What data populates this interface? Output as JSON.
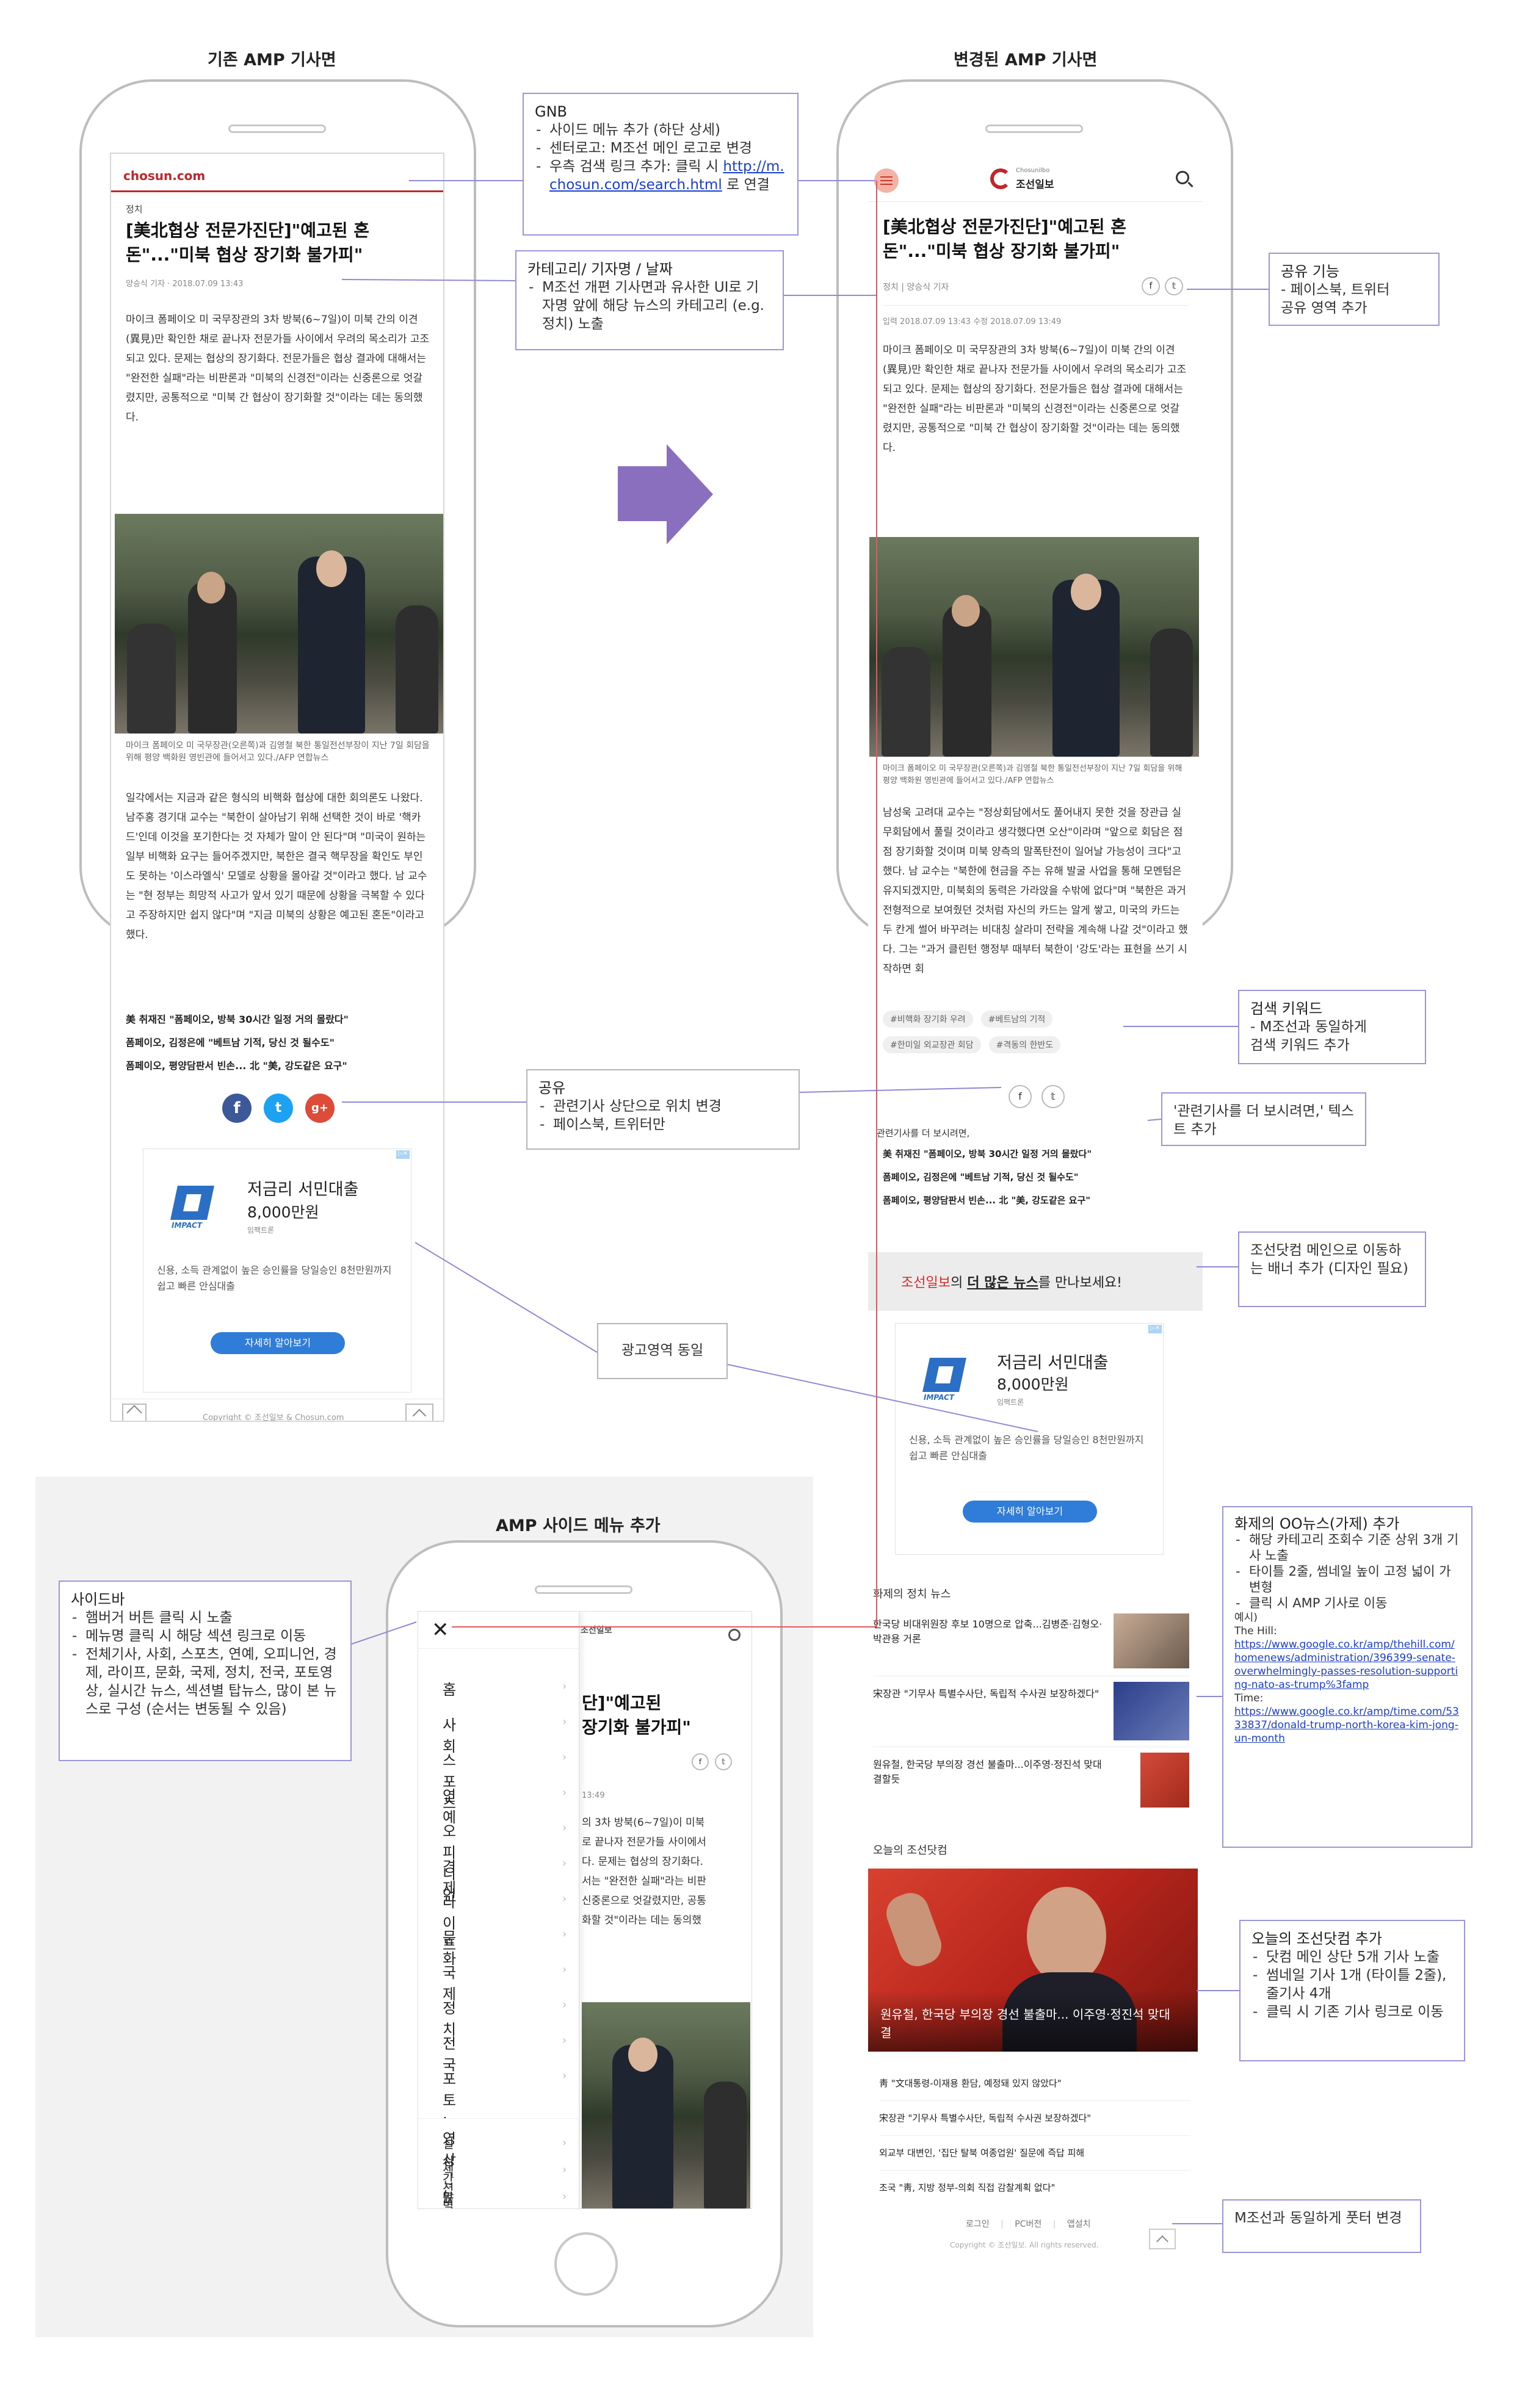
{
  "titles": {
    "left": "기존 AMP 기사면",
    "right": "변경된 AMP 기사면",
    "side": "AMP 사이드 메뉴 추가"
  },
  "left_phone": {
    "logo": "chosun.com",
    "category": "정치",
    "headline": "[美北협상 전문가진단]\"예고된 혼돈\"...\"미북 협상 장기화 불가피\"",
    "meta": "양승식 기자 · 2018.07.09 13:43",
    "lede": "마이크 폼페이오 미 국무장관의 3차 방북(6~7일)이 미북 간의 이견(異見)만 확인한 채로 끝나자 전문가들 사이에서 우려의 목소리가 고조되고 있다. 문제는 협상의 장기화다. 전문가들은 협상 결과에 대해서는 \"완전한 실패\"라는 비판론과 \"미북의 신경전\"이라는 신중론으로 엇갈렸지만, 공통적으로 \"미북 간 협상이 장기화할 것\"이라는 데는 동의했다.",
    "caption": "마이크 폼페이오 미 국무장관(오른쪽)과 김영철 북한 통일전선부장이 지난 7일 회담을 위해 평양 백화원 영빈관에 들어서고 있다./AFP 연합뉴스",
    "body": "일각에서는 지금과 같은 형식의 비핵화 협상에 대한 회의론도 나왔다. 남주홍 경기대 교수는 \"북한이 살아남기 위해 선택한 것이 바로 '핵카드'인데 이것을 포기한다는 것 자체가 말이 안 된다\"며 \"미국이 원하는 일부 비핵화 요구는 들어주겠지만, 북한은 결국 핵무장을 확인도 부인도 못하는 '이스라엘식' 모델로 상황을 몰아갈 것\"이라고 했다. 남 교수는 \"현 정부는 희망적 사고가 앞서 있기 때문에 상황을 극복할 수 있다고 주장하지만 쉽지 않다\"며 \"지금 미북의 상황은 예고된 혼돈\"이라고 했다.",
    "related": [
      "美 취재진 \"폼페이오, 방북 30시간 일정 거의 몰랐다\"",
      "폼페이오, 김정은에 \"베트남 기적, 당신 것 될수도\"",
      "폼페이오, 평양담판서 빈손... 北 \"美, 강도같은 요구\""
    ],
    "share": [
      "f",
      "t",
      "g+"
    ],
    "ad": {
      "title": "저금리 서민대출",
      "amount": "8,000만원",
      "sponsor": "임팩트론",
      "desc": "신용, 소득 관계없이 높은 승인률을 당일승인 8천만원까지 쉽고 빠른 안심대출",
      "button": "자세히 알아보기",
      "logo": "IMPACT"
    },
    "footer": "Copyright © 조선일보 & Chosun.com"
  },
  "right_phone": {
    "logo_small": "Chosunilbo",
    "logo": "조선일보",
    "headline": "[美北협상 전문가진단]\"예고된 혼돈\"...\"미북 협상 장기화 불가피\"",
    "category_meta": "정치 | 양승식 기자",
    "meta": "입력 2018.07.09 13:43 수정 2018.07.09 13:49",
    "lede": "마이크 폼페이오 미 국무장관의 3차 방북(6~7일)이 미북 간의 이견(異見)만 확인한 채로 끝나자 전문가들 사이에서 우려의 목소리가 고조되고 있다. 문제는 협상의 장기화다. 전문가들은 협상 결과에 대해서는 \"완전한 실패\"라는 비판론과 \"미북의 신경전\"이라는 신중론으로 엇갈렸지만, 공통적으로 \"미북 간 협상이 장기화할 것\"이라는 데는 동의했다.",
    "caption": "마이크 폼페이오 미 국무장관(오른쪽)과 김영철 북한 통일전선부장이 지난 7일 회담을 위해 평양 백화원 영빈관에 들어서고 있다./AFP 연합뉴스",
    "body": "남성욱 고려대 교수는 \"정상회담에서도 풀어내지 못한 것을 장관급 실무회담에서 풀릴 것이라고 생각했다면 오산\"이라며 \"앞으로 회담은 점점 장기화할 것이며 미북 양측의 말폭탄전이 일어날 가능성이 크다\"고 했다. 남 교수는 \"북한에 현금을 주는 유해 발굴 사업을 통해 모멘텀은 유지되겠지만, 미북회의 동력은 가라앉을 수밖에 없다\"며 \"북한은 과거 전형적으로 보여줬던 것처럼 자신의 카드는 알게 쌓고, 미국의 카드는 두 칸게 썰어 바꾸려는 비대칭 살라미 전략을 계속해 나갈 것\"이라고 했다. 그는 \"과거 클린턴 행정부 때부터 북한이 '강도'라는 표현을 쓰기 시작하면 회",
    "tags": [
      "#비핵화 장기화 우려",
      "#베트남의 기적",
      "#한미일 외교장관 회담",
      "#격동의 한반도"
    ],
    "related_label": "관련기사를 더 보시려면,",
    "related": [
      "美 취재진 \"폼페이오, 방북 30시간 일정 거의 몰랐다\"",
      "폼페이오, 김정은에 \"베트남 기적, 당신 것 될수도\"",
      "폼페이오, 평양담판서 빈손... 北 \"美, 강도같은 요구\""
    ],
    "banner": {
      "brand": "조선일보",
      "mid": "의 ",
      "bold": "더 많은 뉴스",
      "end": "를 만나보세요!"
    },
    "ad": {
      "title": "저금리 서민대출",
      "amount": "8,000만원",
      "sponsor": "임팩트론",
      "desc": "신용, 소득 관계없이 높은 승인률을 당일승인 8천만원까지 쉽고 빠른 안심대출",
      "button": "자세히 알아보기",
      "logo": "IMPACT"
    },
    "topic_title": "화제의 정치 뉴스",
    "topic_items": [
      "한국당 비대위원장 후보 10명으로 압축...김병준·김형오·박관용 거론",
      "宋장관 \"기무사 특별수사단, 독립적 수사권 보장하겠다\"",
      "원유철, 한국당 부의장 경선 불출마...이주영·정진석 맞대결할듯"
    ],
    "today_title": "오늘의 조선닷컴",
    "today_caption": "원유철, 한국당 부의장 경선 불출마... 이주영·정진석 맞대결",
    "today_items": [
      "靑 \"文대통령-이재용 환담, 예정돼 있지 않았다\"",
      "宋장관 \"기무사 특별수사단, 독립적 수사권 보장하겠다\"",
      "외교부 대변인, '집단 탈북 여종업원' 질문에 즉답 피해",
      "조국 \"靑, 지방 정부-의회 직접 감찰계획 없다\""
    ],
    "footer_links": [
      "로그인",
      "PC버전",
      "앱설치"
    ],
    "footer": "Copyright © 조선일보. All rights reserved."
  },
  "side_phone": {
    "menu": [
      "홈",
      "사회",
      "스포츠",
      "연예",
      "오피니언",
      "경제",
      "라이프",
      "문화",
      "국제",
      "정치",
      "전국",
      "포토·영상"
    ],
    "menu_bottom": [
      "실시간 뉴스",
      "섹션별 탑뉴스",
      "많이 본 뉴스"
    ],
    "bg_headline": "단]\"예고된\n장기화 불가피\"",
    "bg_meta": "13:49",
    "bg_text": "의 3차 방북(6~7일)이 미북\n로 끝나자 전문가들 사이에서\n다. 문제는 협상의 장기화다.\n서는 \"완전한 실패\"라는 비판\n신중론으로 엇갈렸지만, 공통\n화할 것\"이라는 데는 동의했",
    "bg_logo": "조선일보"
  },
  "notes": {
    "gnb": {
      "title": "GNB",
      "items": [
        "사이드 메뉴 추가 (하단 상세)",
        "센터로고: M조선 메인 로고로 변경",
        "우측 검색 링크 추가: 클릭 시"
      ],
      "link": "http://m.chosun.com/search.html",
      "link_suffix": " 로 연결"
    },
    "category": {
      "title": "카테고리/ 기자명 / 날짜",
      "items": [
        "M조선 개편 기사면과 유사한 UI로 기자명 앞에 해당 뉴스의 카테고리 (e.g.정치) 노출"
      ]
    },
    "share_func": {
      "title": "공유 기능",
      "lines": [
        "- 페이스북, 트위터",
        "공유 영역 추가"
      ]
    },
    "keyword": {
      "title": "검색 키워드",
      "lines": [
        "- M조선과 동일하게",
        "검색 키워드 추가"
      ]
    },
    "share": {
      "title": "공유",
      "items": [
        "관련기사 상단으로 위치 변경",
        "페이스북, 트위터만"
      ]
    },
    "related": {
      "text": "'관련기사를 더 보시려면,' 텍스트 추가"
    },
    "banner": {
      "text": "조선닷컴 메인으로 이동하는 배너 추가 (디자인 필요)"
    },
    "ad": {
      "text": "광고영역 동일"
    },
    "topic": {
      "title": "화제의 OO뉴스(가제) 추가",
      "items": [
        "해당 카테고리 조회수 기준 상위 3개 기사 노출",
        "타이틀 2줄, 썸네일 높이 고정 넓이 가변형",
        "클릭 시 AMP 기사로 이동"
      ],
      "example_label": "예시)",
      "src1": "The Hill:",
      "link1": "https://www.google.co.kr/amp/thehill.com/homenews/administration/396399-senate-overwhelmingly-passes-resolution-supporting-nato-as-trump%3famp",
      "src2": "Time:",
      "link2": "https://www.google.co.kr/amp/time.com/5333837/donald-trump-north-korea-kim-jong-un-month"
    },
    "sidebar": {
      "title": "사이드바",
      "items": [
        "햄버거 버튼 클릭 시 노출",
        "메뉴명 클릭 시 해당 섹션 링크로 이동",
        "전체기사, 사회, 스포츠, 연예, 오피니언, 경제, 라이프, 문화, 국제, 정치, 전국, 포토영상, 실시간 뉴스, 섹션별 탑뉴스, 많이 본 뉴스로 구성 (순서는 변동될 수 있음)"
      ]
    },
    "today": {
      "title": "오늘의 조선닷컴 추가",
      "items": [
        "닷컴 메인 상단 5개 기사 노출",
        "썸네일 기사 1개 (타이틀 2줄), 줄기사 4개",
        "클릭 시 기존 기사 링크로 이동"
      ]
    },
    "footer": {
      "text": "M조선과 동일하게 풋터 변경"
    }
  },
  "colors": {
    "accent_purple": "#8a6fbf",
    "note_border": "#9b96d9",
    "chosun_red": "#d62b2b",
    "share_fb": "#3b5998",
    "share_tw": "#1da1f2",
    "share_gp": "#dd4b39"
  }
}
